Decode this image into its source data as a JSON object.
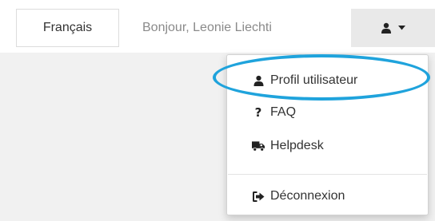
{
  "header": {
    "language_button": "Français",
    "greeting": "Bonjour, Leonie Liechti",
    "user_menu_icon": "user-icon",
    "dropdown_caret_icon": "caret-down-icon"
  },
  "user_menu": {
    "items": [
      {
        "label": "Profil utilisateur",
        "icon": "user-icon"
      },
      {
        "label": "FAQ",
        "icon": "question-icon"
      },
      {
        "label": "Helpdesk",
        "icon": "truck-icon"
      },
      {
        "label": "Déconnexion",
        "icon": "sign-out-icon"
      }
    ]
  },
  "annotation": {
    "highlight_color": "#1fa3dc"
  }
}
